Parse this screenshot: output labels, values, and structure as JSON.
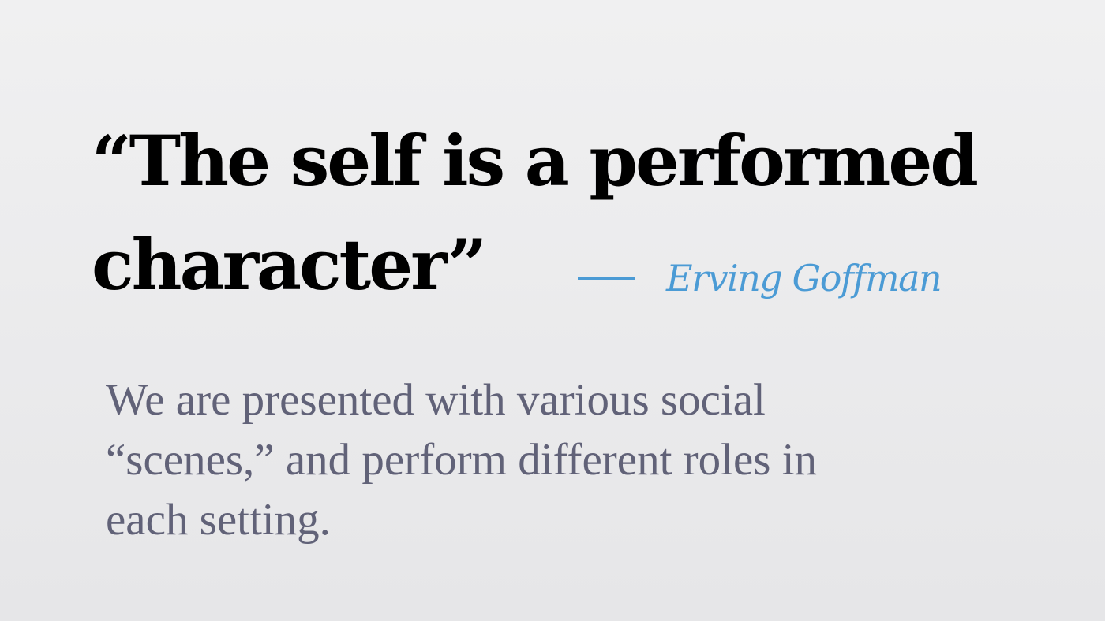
{
  "quote": {
    "line1": "“The self is a performed",
    "line2": "character”"
  },
  "attribution": {
    "author": "Erving Goffman"
  },
  "description": {
    "line1": "We are presented with various social",
    "line2": "“scenes,” and perform different roles in",
    "line3": "each setting."
  },
  "colors": {
    "quote": "#000000",
    "accent": "#4b9bd5",
    "body": "#616278",
    "background": "#ececed"
  }
}
